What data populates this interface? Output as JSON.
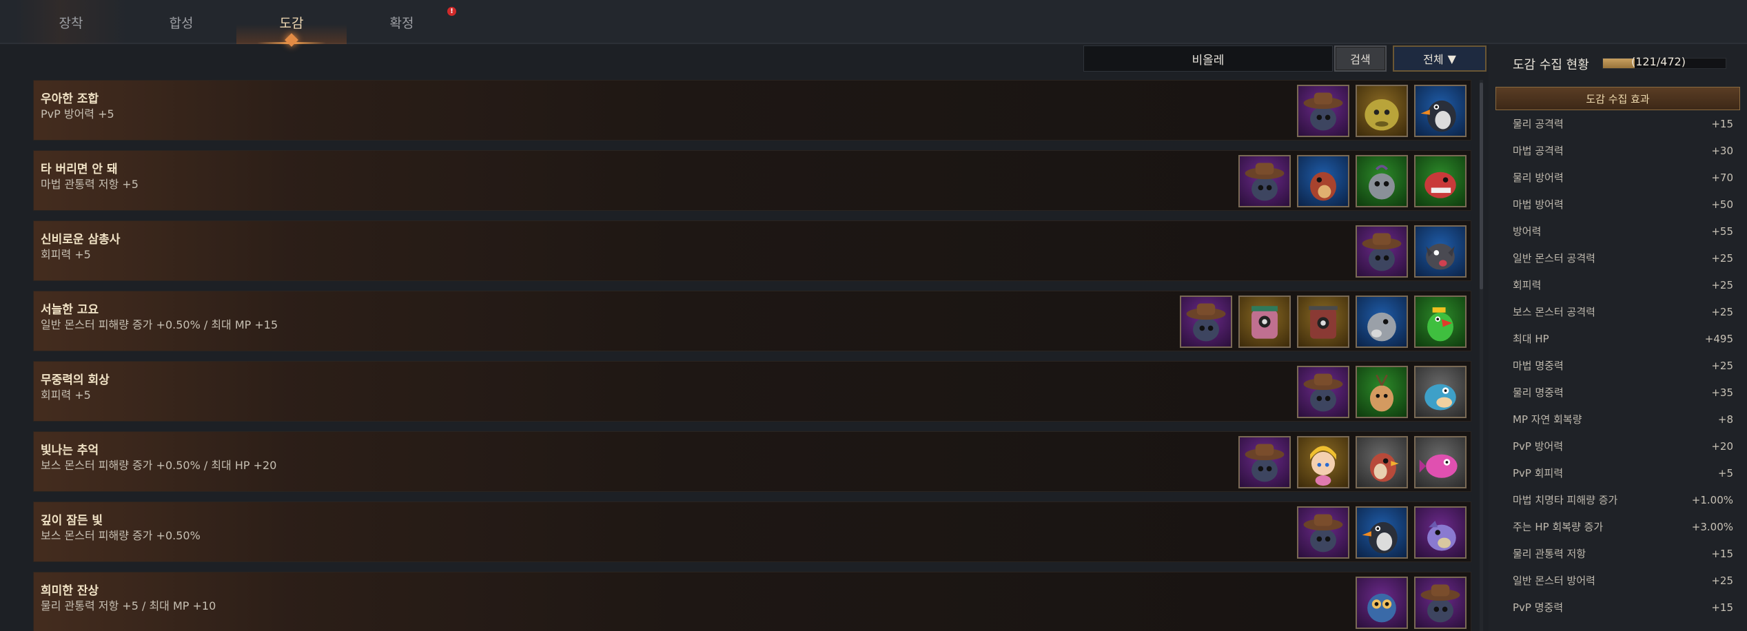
{
  "tabs": [
    {
      "label": "장착"
    },
    {
      "label": "합성"
    },
    {
      "label": "도감"
    },
    {
      "label": "확정"
    }
  ],
  "alert": "!",
  "search": {
    "value": "비올레",
    "button": "검색",
    "filter": "전체",
    "filter_arrow": "▼"
  },
  "rows": [
    {
      "title": "우아한 조합",
      "desc": "PvP 방어력 +5"
    },
    {
      "title": "타 버리면 안 돼",
      "desc": "마법 관통력 저항 +5"
    },
    {
      "title": "신비로운 삼총사",
      "desc": "회피력 +5"
    },
    {
      "title": "서늘한 고요",
      "desc": "일반 몬스터 피해량 증가 +0.50% / 최대 MP +15"
    },
    {
      "title": "무중력의 회상",
      "desc": "회피력 +5"
    },
    {
      "title": "빛나는 추억",
      "desc": "보스 몬스터 피해량 증가 +0.50% / 최대 HP +20"
    },
    {
      "title": "깊이 잠든 빛",
      "desc": "보스 몬스터 피해량 증가 +0.50%"
    },
    {
      "title": "희미한 잔상",
      "desc": "물리 관통력 저항 +5 / 최대 MP +10"
    }
  ],
  "side": {
    "title": "도감 수집 현황",
    "progress_text": "(121/472)",
    "progress": 0.256,
    "effect_header": "도감 수집 효과",
    "stats": [
      {
        "label": "물리 공격력",
        "value": "+15"
      },
      {
        "label": "마법 공격력",
        "value": "+30"
      },
      {
        "label": "물리 방어력",
        "value": "+70"
      },
      {
        "label": "마법 방어력",
        "value": "+50"
      },
      {
        "label": "방어력",
        "value": "+55"
      },
      {
        "label": "일반 몬스터 공격력",
        "value": "+25"
      },
      {
        "label": "회피력",
        "value": "+25"
      },
      {
        "label": "보스 몬스터 공격력",
        "value": "+25"
      },
      {
        "label": "최대 HP",
        "value": "+495"
      },
      {
        "label": "마법 명중력",
        "value": "+25"
      },
      {
        "label": "물리 명중력",
        "value": "+35"
      },
      {
        "label": "MP 자연 회복량",
        "value": "+8"
      },
      {
        "label": "PvP 방어력",
        "value": "+20"
      },
      {
        "label": "PvP 회피력",
        "value": "+5"
      },
      {
        "label": "마법 치명타 피해량 증가",
        "value": "+1.00%"
      },
      {
        "label": "주는 HP 회복량 증가",
        "value": "+3.00%"
      },
      {
        "label": "물리 관통력 저항",
        "value": "+15"
      },
      {
        "label": "일반 몬스터 방어력",
        "value": "+25"
      },
      {
        "label": "PvP 명중력",
        "value": "+15"
      }
    ]
  },
  "colors": {
    "accent": "#e28b45",
    "gold": "#c8a060",
    "panel": "#1f2227"
  }
}
